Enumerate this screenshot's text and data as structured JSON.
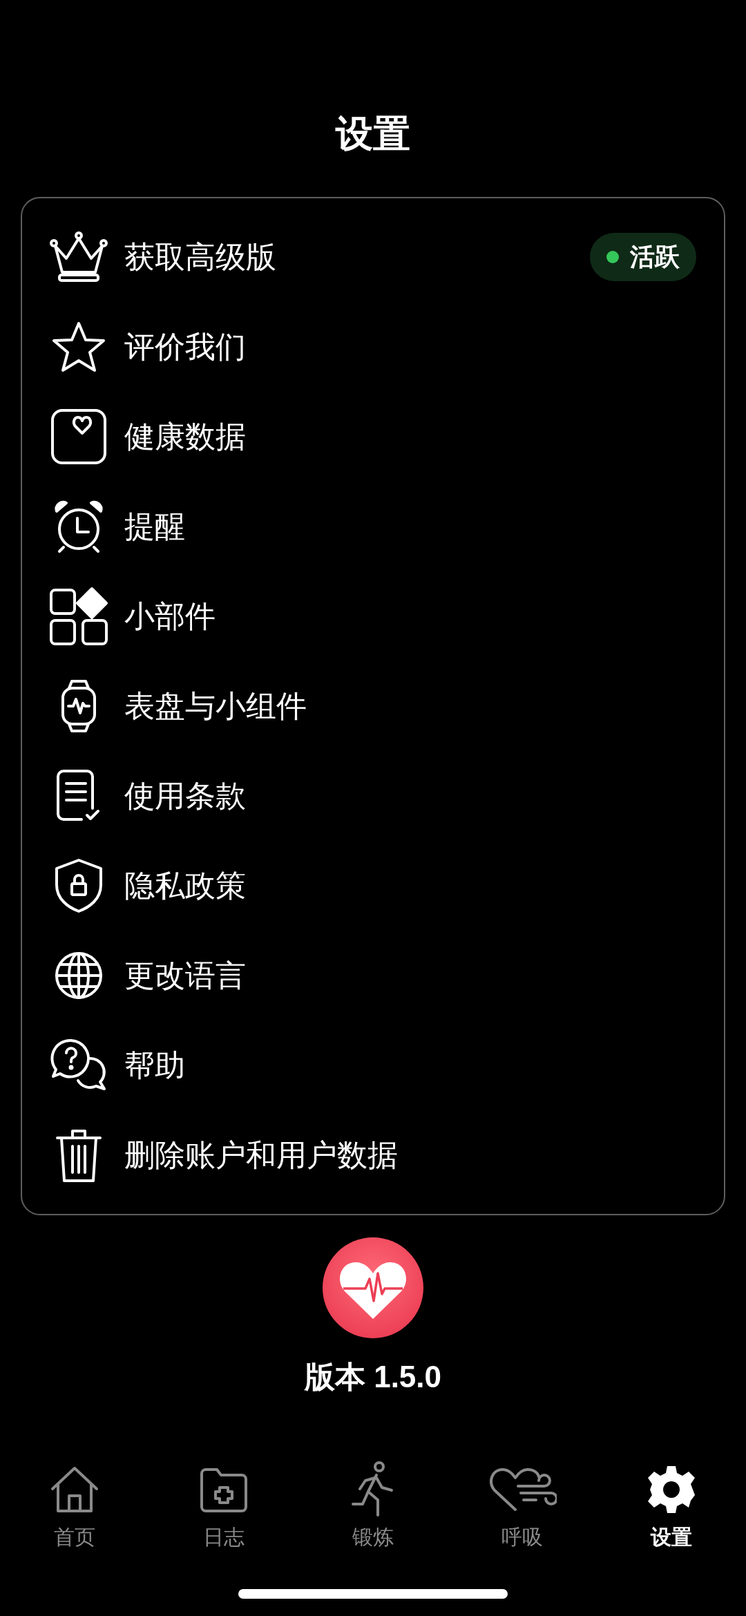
{
  "header": {
    "title": "设置"
  },
  "menu": [
    {
      "label": "获取高级版",
      "badge": "活跃"
    },
    {
      "label": "评价我们"
    },
    {
      "label": "健康数据"
    },
    {
      "label": "提醒"
    },
    {
      "label": "小部件"
    },
    {
      "label": "表盘与小组件"
    },
    {
      "label": "使用条款"
    },
    {
      "label": "隐私政策"
    },
    {
      "label": "更改语言"
    },
    {
      "label": "帮助"
    },
    {
      "label": "删除账户和用户数据"
    }
  ],
  "version": "版本 1.5.0",
  "tabs": [
    {
      "label": "首页",
      "selected": false
    },
    {
      "label": "日志",
      "selected": false
    },
    {
      "label": "锻炼",
      "selected": false
    },
    {
      "label": "呼吸",
      "selected": false
    },
    {
      "label": "设置",
      "selected": true
    }
  ]
}
